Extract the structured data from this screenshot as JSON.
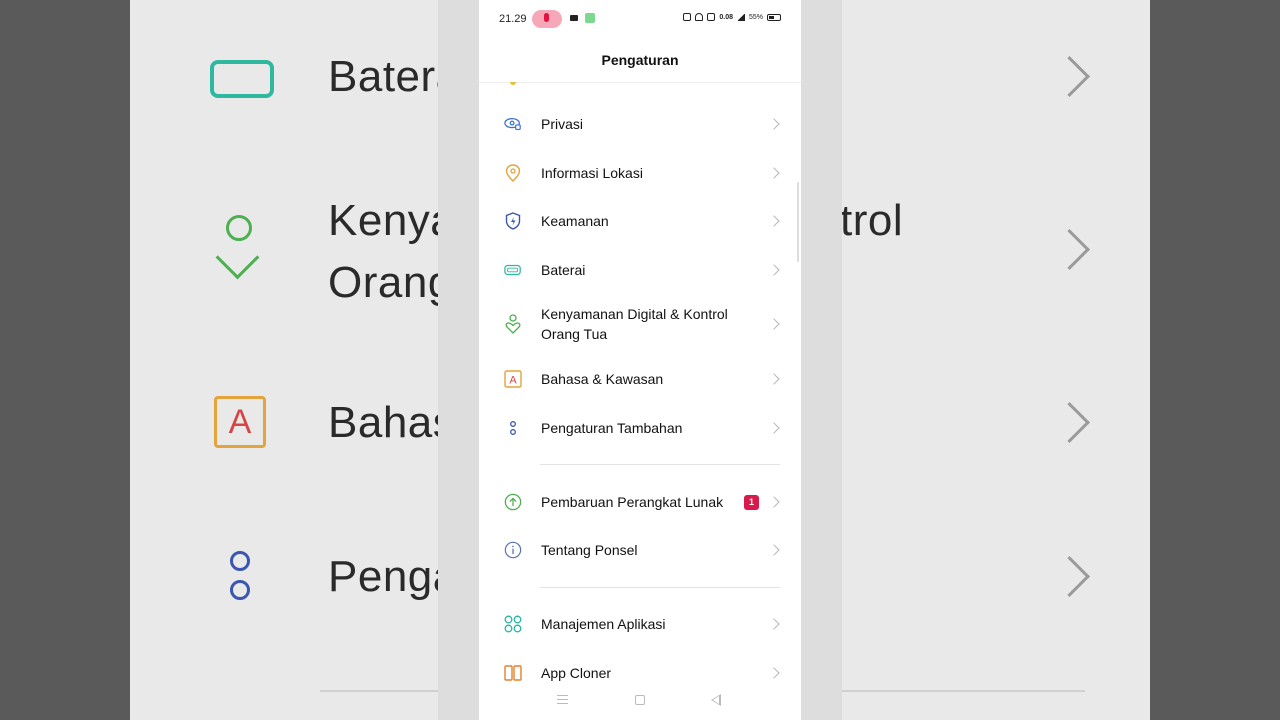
{
  "status_bar": {
    "time": "21.29",
    "net_speed": "0.08",
    "battery": "55%"
  },
  "header": {
    "title": "Pengaturan"
  },
  "menu": {
    "group1": [
      {
        "label": "Privasi",
        "icon": "privacy-eye-icon"
      },
      {
        "label": "Informasi Lokasi",
        "icon": "location-pin-icon"
      },
      {
        "label": "Keamanan",
        "icon": "security-shield-icon"
      },
      {
        "label": "Baterai",
        "icon": "battery-icon"
      },
      {
        "label": "Kenyamanan Digital & Kontrol Orang Tua",
        "icon": "digital-wellbeing-icon"
      },
      {
        "label": "Bahasa & Kawasan",
        "icon": "language-icon"
      },
      {
        "label": "Pengaturan Tambahan",
        "icon": "additional-settings-icon"
      }
    ],
    "group2": [
      {
        "label": "Pembaruan Perangkat Lunak",
        "icon": "update-arrow-icon",
        "badge": "1"
      },
      {
        "label": "Tentang Ponsel",
        "icon": "info-icon"
      }
    ],
    "group3": [
      {
        "label": "Manajemen Aplikasi",
        "icon": "app-management-icon"
      },
      {
        "label": "App Cloner",
        "icon": "app-cloner-icon"
      }
    ]
  },
  "background": {
    "rows": [
      "Batera",
      "Kenya",
      "Orang",
      "Bahas",
      "Penga"
    ],
    "fragment": "ntrol"
  },
  "colors": {
    "badge": "#d81b4a",
    "privacy": "#3b6fd4",
    "location": "#e3a43b",
    "security": "#3b56b0",
    "battery": "#2fb8a0",
    "wellbeing": "#4caf50",
    "language": "#e3a43b",
    "update": "#4caf50",
    "apps": "#26b5a3",
    "cloner": "#e0822f"
  }
}
